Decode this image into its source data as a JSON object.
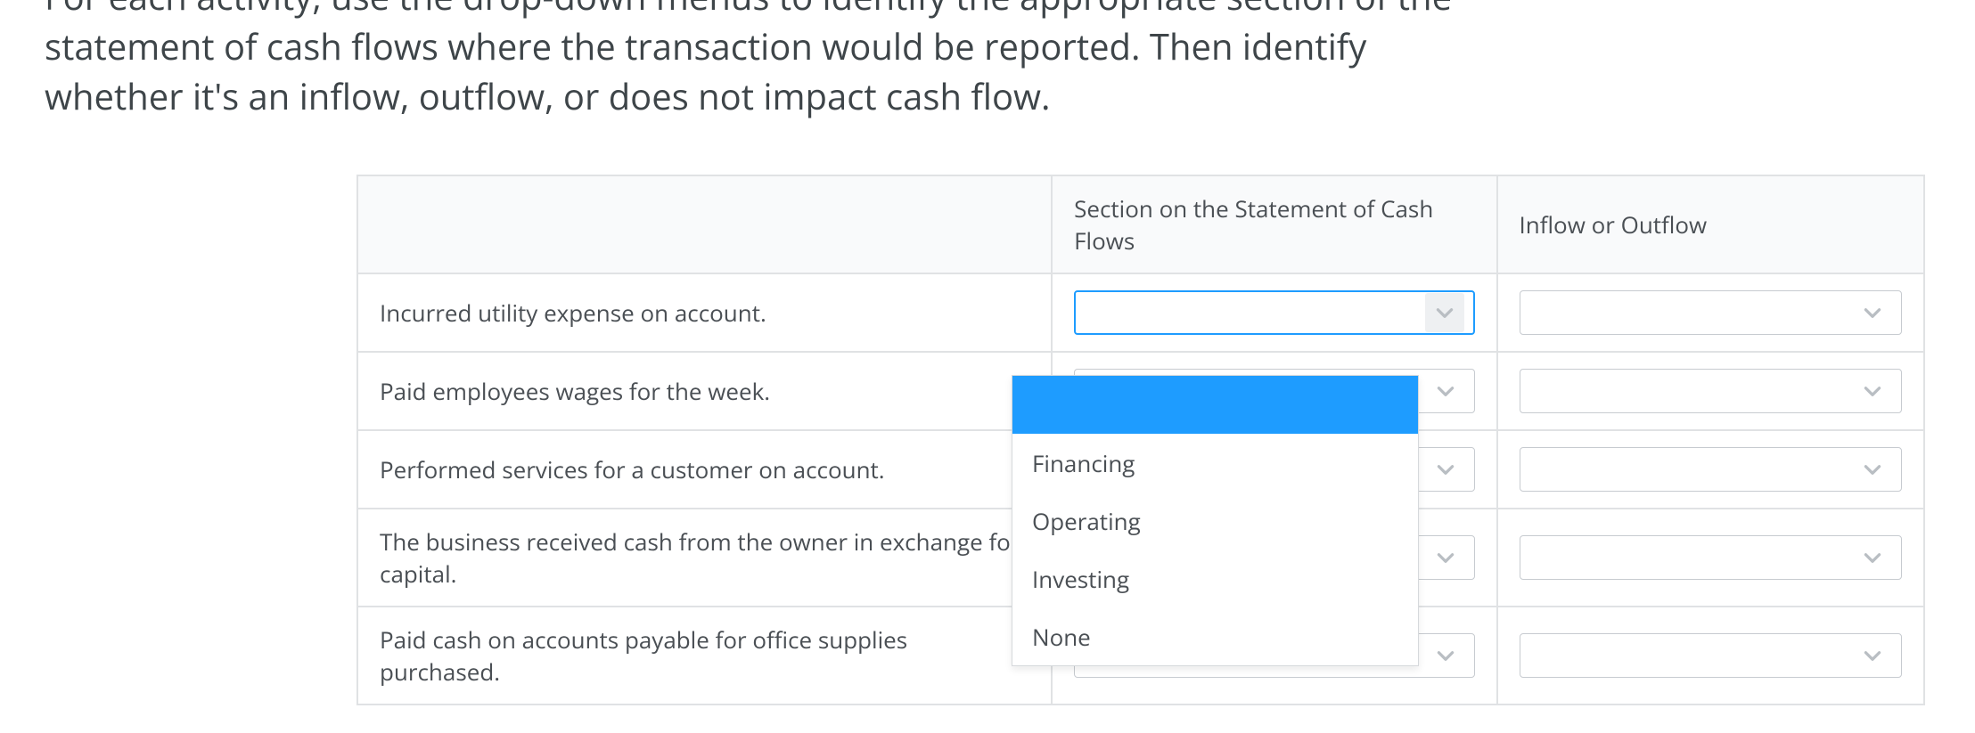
{
  "instructions": {
    "line1": "For each activity, use the drop-down menus to identify the appropriate section of the",
    "line2": "statement of cash flows where the transaction would be reported. Then identify",
    "line3": "whether it's an inflow, outflow, or does not impact cash flow."
  },
  "headers": {
    "blank": "",
    "section": "Section on the Statement of Cash Flows",
    "flow": "Inflow or Outflow"
  },
  "rows": [
    {
      "label": "Incurred utility expense on account."
    },
    {
      "label": "Paid employees wages for the week."
    },
    {
      "label": "Performed services for a customer on account."
    },
    {
      "label": "The business received cash from the owner in exchange for capital."
    },
    {
      "label": "Paid cash on accounts payable for office supplies purchased."
    }
  ],
  "dropdown_options": {
    "blank": "",
    "opt1": "Financing",
    "opt2": "Operating",
    "opt3": "Investing",
    "opt4": "None"
  }
}
